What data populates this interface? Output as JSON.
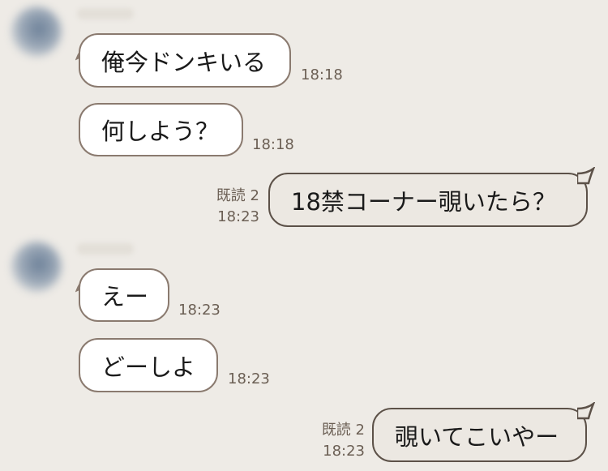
{
  "messages": [
    {
      "side": "left",
      "text": "俺今ドンキいる",
      "time": "18:18"
    },
    {
      "side": "left",
      "text": "何しよう？",
      "time": "18:18"
    },
    {
      "side": "right",
      "text": "18禁コーナー覗いたら？",
      "read": "既読 2",
      "time": "18:23"
    },
    {
      "side": "left",
      "text": "えー",
      "time": "18:23"
    },
    {
      "side": "left",
      "text": "どーしよ",
      "time": "18:23"
    },
    {
      "side": "right",
      "text": "覗いてこいやー",
      "read": "既読 2",
      "time": "18:23"
    }
  ],
  "colors": {
    "background": "#eeebe6",
    "incoming_bubble": "#ffffff",
    "outgoing_bubble": "#ece8e2",
    "bubble_border": "#8a7a6f",
    "time_text": "#6b5f54"
  },
  "icons": [
    "avatar",
    "bubble-tail"
  ]
}
